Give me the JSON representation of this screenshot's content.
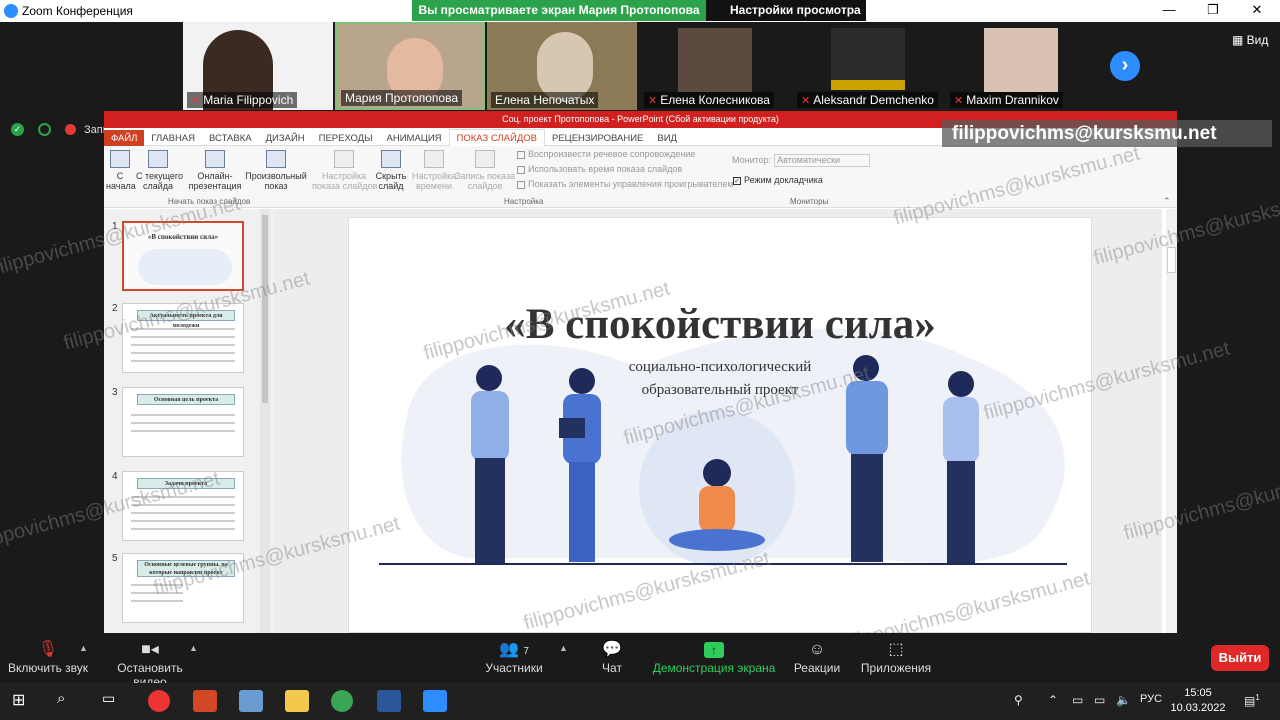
{
  "titlebar": {
    "title": "Zoom Конференция",
    "minimize": "—",
    "restore": "❐",
    "close": "✕"
  },
  "share": {
    "banner": "Вы просматриваете экран Мария Протопопова",
    "view_options": "Настройки просмотра"
  },
  "participants": [
    {
      "name": "Maria Filippovich",
      "muted": true
    },
    {
      "name": "Мария Протопопова",
      "muted": false
    },
    {
      "name": "Елена Непочатых",
      "muted": false
    },
    {
      "name": "Елена Колесникова",
      "muted": true
    },
    {
      "name": "Aleksandr Demchenko",
      "muted": true
    },
    {
      "name": "Maxim Drannikov",
      "muted": true
    }
  ],
  "view_button": "Вид",
  "recording": "Запис",
  "ppt": {
    "title": "Соц. проект Протопопова -  PowerPoint (Сбой активации продукта)",
    "tabs": [
      "ФАЙЛ",
      "ГЛАВНАЯ",
      "ВСТАВКА",
      "ДИЗАЙН",
      "ПЕРЕХОДЫ",
      "АНИМАЦИЯ",
      "ПОКАЗ СЛАЙДОВ",
      "РЕЦЕНЗИРОВАНИЕ",
      "ВИД"
    ],
    "ribbon": {
      "from_start": "С\nначала",
      "from_current": "С текущего\nслайда",
      "online": "Онлайн-\nпрезентация",
      "custom": "Произвольный\nпоказ",
      "setup": "Настройка\nпоказа слайдов",
      "hide": "Скрыть\nслайд",
      "rehearse": "Настройка\nвремени",
      "record": "Запись показа\nслайдов",
      "chk_narration": "Воспроизвести речевое сопровождение",
      "chk_timings": "Использовать время показа слайдов",
      "chk_controls": "Показать элементы управления проигрывателем",
      "monitor_label": "Монитор:",
      "monitor_value": "Автоматически",
      "presenter_view": "Режим докладчика",
      "group_start": "Начать показ слайдов",
      "group_setup": "Настройка",
      "group_monitors": "Мониторы"
    },
    "thumbnails": [
      {
        "num": "1",
        "title": "«В спокойствии сила»"
      },
      {
        "num": "2",
        "title": "Актуальность проекта для молодежи"
      },
      {
        "num": "3",
        "title": "Основная цель проекта"
      },
      {
        "num": "4",
        "title": "Задачи проекта"
      },
      {
        "num": "5",
        "title": "Основные целевые группы, на которые направлен проект"
      }
    ],
    "slide": {
      "title": "«В спокойствии сила»",
      "subtitle_1": "социально-психологический",
      "subtitle_2": "образовательный проект"
    }
  },
  "watermark": "filippovichms@kursksmu.net",
  "email_overlay": "filippovichms@kursksmu.net",
  "toolbar": {
    "unmute": "Включить звук",
    "stop_video": "Остановить видео",
    "participants": "Участники",
    "participants_count": "7",
    "chat": "Чат",
    "share": "Демонстрация экрана",
    "reactions": "Реакции",
    "apps": "Приложения",
    "leave": "Выйти"
  },
  "taskbar": {
    "lang": "РУС",
    "time": "15:05",
    "date": "10.03.2022",
    "notif": "1"
  }
}
